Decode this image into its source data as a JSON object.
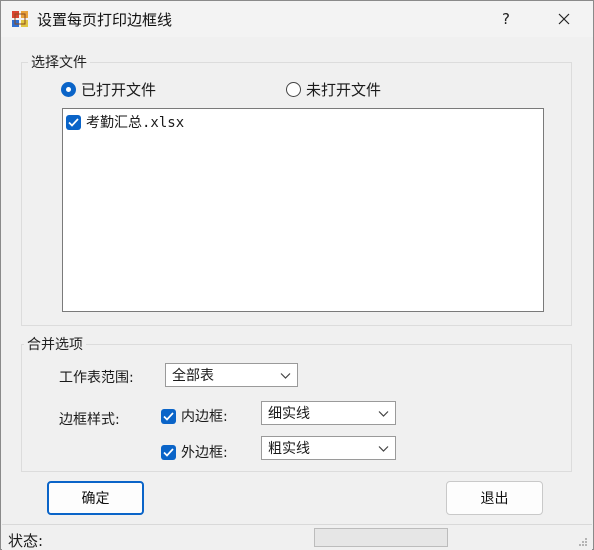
{
  "window": {
    "title": "设置每页打印边框线",
    "help_label": "?",
    "close_label": "✕"
  },
  "file_group": {
    "title": "选择文件",
    "radio_opened": "已打开文件",
    "radio_unopened": "未打开文件",
    "selected_radio": "已打开文件",
    "files": [
      {
        "name": "考勤汇总",
        "ext": ".xlsx",
        "checked": true
      }
    ]
  },
  "merge_group": {
    "title": "合并选项",
    "sheet_range_label": "工作表范围:",
    "sheet_range_value": "全部表",
    "border_style_label": "边框样式:",
    "inner_border_label": "内边框:",
    "inner_border_value": "细实线",
    "inner_border_checked": true,
    "outer_border_label": "外边框:",
    "outer_border_value": "粗实线",
    "outer_border_checked": true
  },
  "buttons": {
    "ok_label": "确定",
    "exit_label": "退出"
  },
  "status": {
    "label": "状态:",
    "progress": 0
  },
  "colors": {
    "accent": "#0a64c8",
    "window_bg": "#f0f0f0"
  }
}
